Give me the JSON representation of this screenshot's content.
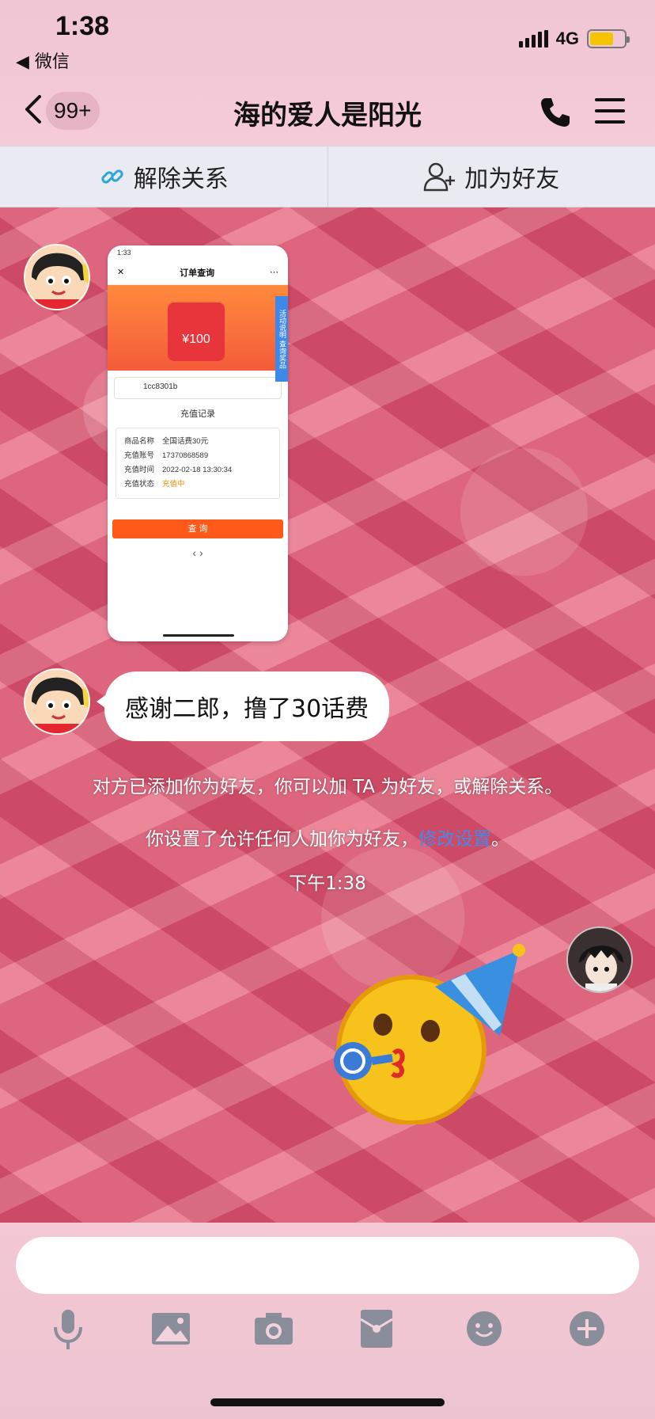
{
  "status_bar": {
    "time": "1:38",
    "back_app": "◀ 微信",
    "network": "4G"
  },
  "nav": {
    "badge": "99+",
    "title": "海的爱人是阳光"
  },
  "actions": {
    "unbind_label": "解除关系",
    "add_friend_label": "加为好友"
  },
  "screenshot": {
    "time": "1:33",
    "title": "订单查询",
    "banner_amount": "¥100",
    "side_tab": "活动说明",
    "side_tab2": "查询奖品",
    "input_value": "1cc8301b",
    "section_title": "充值记录",
    "rows": [
      {
        "k": "商品名称",
        "v": "全国话费30元"
      },
      {
        "k": "充值账号",
        "v": "17370868589"
      },
      {
        "k": "充值时间",
        "v": "2022-02-18 13:30:34"
      },
      {
        "k": "充值状态",
        "v": "充值中"
      }
    ],
    "button": "查 询",
    "nav": "‹        ›"
  },
  "messages": {
    "bubble_text": "感谢二郎，撸了30话费",
    "system_1": "对方已添加你为好友，你可以加 TA 为好友，或解除关系。",
    "system_2_prefix": "你设置了允许任何人加你为好友，",
    "system_2_link": "修改设置",
    "system_2_suffix": "。",
    "timestamp": "下午1:38"
  },
  "composer": {
    "placeholder": ""
  },
  "toolbar_icons": [
    "microphone-icon",
    "image-icon",
    "camera-icon",
    "red-packet-icon",
    "emoji-icon",
    "plus-icon"
  ],
  "colors": {
    "link": "#4c86e6",
    "battery": "#f5c400",
    "order_button": "#ff5a1a",
    "status_pending": "#f08c00"
  }
}
